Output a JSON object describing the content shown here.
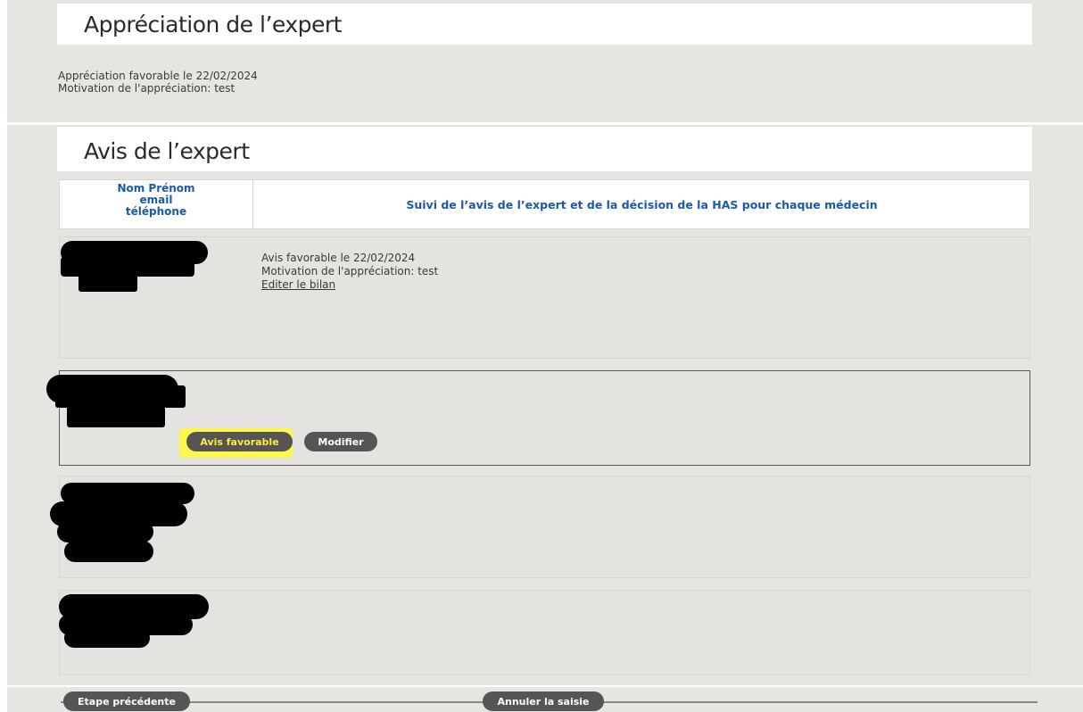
{
  "sections": {
    "appreciation": {
      "title": "Appréciation de l’expert",
      "line1": "Appréciation favorable le 22/02/2024",
      "line2": "Motivation de l'appréciation: test"
    },
    "avis": {
      "title": "Avis de l’expert",
      "table": {
        "col1_line1": "Nom Prénom",
        "col1_line2": "email",
        "col1_line3": "téléphone",
        "col2": "Suivi de l’avis de l’expert et de la décision de la HAS pour chaque médecin"
      },
      "rows": [
        {
          "detail_line1": "Avis favorable le 22/02/2024",
          "detail_line2": "Motivation de l'appréciation: test",
          "link": "Editer le bilan"
        },
        {
          "btn_favorable": "Avis favorable",
          "btn_modifier": "Modifier"
        }
      ]
    }
  },
  "footer": {
    "prev": "Etape précédente",
    "cancel": "Annuler la saisie"
  },
  "colors": {
    "accent_blue": "#1b5aa6",
    "highlight_yellow": "#fff84a",
    "button_gray": "#555555"
  }
}
